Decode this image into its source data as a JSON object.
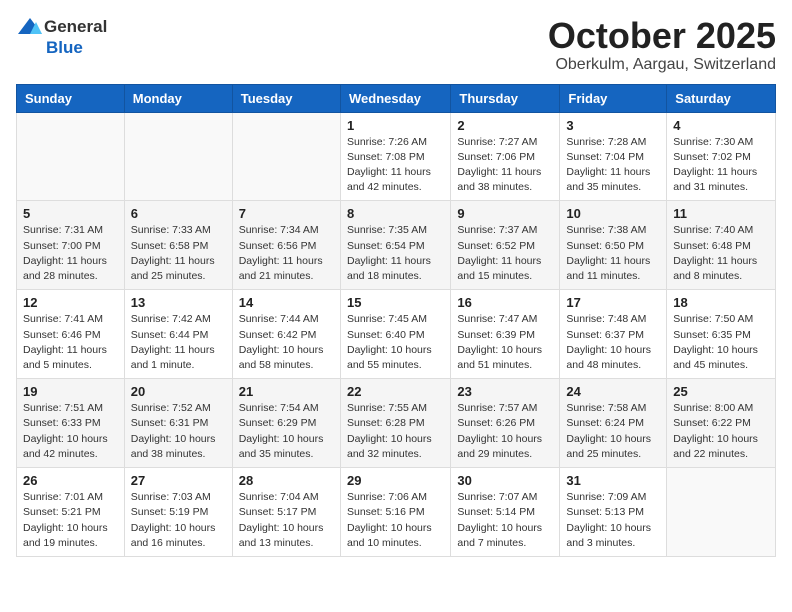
{
  "header": {
    "logo_general": "General",
    "logo_blue": "Blue",
    "month": "October 2025",
    "location": "Oberkulm, Aargau, Switzerland"
  },
  "weekdays": [
    "Sunday",
    "Monday",
    "Tuesday",
    "Wednesday",
    "Thursday",
    "Friday",
    "Saturday"
  ],
  "weeks": [
    [
      {
        "day": "",
        "sunrise": "",
        "sunset": "",
        "daylight": ""
      },
      {
        "day": "",
        "sunrise": "",
        "sunset": "",
        "daylight": ""
      },
      {
        "day": "",
        "sunrise": "",
        "sunset": "",
        "daylight": ""
      },
      {
        "day": "1",
        "sunrise": "Sunrise: 7:26 AM",
        "sunset": "Sunset: 7:08 PM",
        "daylight": "Daylight: 11 hours and 42 minutes."
      },
      {
        "day": "2",
        "sunrise": "Sunrise: 7:27 AM",
        "sunset": "Sunset: 7:06 PM",
        "daylight": "Daylight: 11 hours and 38 minutes."
      },
      {
        "day": "3",
        "sunrise": "Sunrise: 7:28 AM",
        "sunset": "Sunset: 7:04 PM",
        "daylight": "Daylight: 11 hours and 35 minutes."
      },
      {
        "day": "4",
        "sunrise": "Sunrise: 7:30 AM",
        "sunset": "Sunset: 7:02 PM",
        "daylight": "Daylight: 11 hours and 31 minutes."
      }
    ],
    [
      {
        "day": "5",
        "sunrise": "Sunrise: 7:31 AM",
        "sunset": "Sunset: 7:00 PM",
        "daylight": "Daylight: 11 hours and 28 minutes."
      },
      {
        "day": "6",
        "sunrise": "Sunrise: 7:33 AM",
        "sunset": "Sunset: 6:58 PM",
        "daylight": "Daylight: 11 hours and 25 minutes."
      },
      {
        "day": "7",
        "sunrise": "Sunrise: 7:34 AM",
        "sunset": "Sunset: 6:56 PM",
        "daylight": "Daylight: 11 hours and 21 minutes."
      },
      {
        "day": "8",
        "sunrise": "Sunrise: 7:35 AM",
        "sunset": "Sunset: 6:54 PM",
        "daylight": "Daylight: 11 hours and 18 minutes."
      },
      {
        "day": "9",
        "sunrise": "Sunrise: 7:37 AM",
        "sunset": "Sunset: 6:52 PM",
        "daylight": "Daylight: 11 hours and 15 minutes."
      },
      {
        "day": "10",
        "sunrise": "Sunrise: 7:38 AM",
        "sunset": "Sunset: 6:50 PM",
        "daylight": "Daylight: 11 hours and 11 minutes."
      },
      {
        "day": "11",
        "sunrise": "Sunrise: 7:40 AM",
        "sunset": "Sunset: 6:48 PM",
        "daylight": "Daylight: 11 hours and 8 minutes."
      }
    ],
    [
      {
        "day": "12",
        "sunrise": "Sunrise: 7:41 AM",
        "sunset": "Sunset: 6:46 PM",
        "daylight": "Daylight: 11 hours and 5 minutes."
      },
      {
        "day": "13",
        "sunrise": "Sunrise: 7:42 AM",
        "sunset": "Sunset: 6:44 PM",
        "daylight": "Daylight: 11 hours and 1 minute."
      },
      {
        "day": "14",
        "sunrise": "Sunrise: 7:44 AM",
        "sunset": "Sunset: 6:42 PM",
        "daylight": "Daylight: 10 hours and 58 minutes."
      },
      {
        "day": "15",
        "sunrise": "Sunrise: 7:45 AM",
        "sunset": "Sunset: 6:40 PM",
        "daylight": "Daylight: 10 hours and 55 minutes."
      },
      {
        "day": "16",
        "sunrise": "Sunrise: 7:47 AM",
        "sunset": "Sunset: 6:39 PM",
        "daylight": "Daylight: 10 hours and 51 minutes."
      },
      {
        "day": "17",
        "sunrise": "Sunrise: 7:48 AM",
        "sunset": "Sunset: 6:37 PM",
        "daylight": "Daylight: 10 hours and 48 minutes."
      },
      {
        "day": "18",
        "sunrise": "Sunrise: 7:50 AM",
        "sunset": "Sunset: 6:35 PM",
        "daylight": "Daylight: 10 hours and 45 minutes."
      }
    ],
    [
      {
        "day": "19",
        "sunrise": "Sunrise: 7:51 AM",
        "sunset": "Sunset: 6:33 PM",
        "daylight": "Daylight: 10 hours and 42 minutes."
      },
      {
        "day": "20",
        "sunrise": "Sunrise: 7:52 AM",
        "sunset": "Sunset: 6:31 PM",
        "daylight": "Daylight: 10 hours and 38 minutes."
      },
      {
        "day": "21",
        "sunrise": "Sunrise: 7:54 AM",
        "sunset": "Sunset: 6:29 PM",
        "daylight": "Daylight: 10 hours and 35 minutes."
      },
      {
        "day": "22",
        "sunrise": "Sunrise: 7:55 AM",
        "sunset": "Sunset: 6:28 PM",
        "daylight": "Daylight: 10 hours and 32 minutes."
      },
      {
        "day": "23",
        "sunrise": "Sunrise: 7:57 AM",
        "sunset": "Sunset: 6:26 PM",
        "daylight": "Daylight: 10 hours and 29 minutes."
      },
      {
        "day": "24",
        "sunrise": "Sunrise: 7:58 AM",
        "sunset": "Sunset: 6:24 PM",
        "daylight": "Daylight: 10 hours and 25 minutes."
      },
      {
        "day": "25",
        "sunrise": "Sunrise: 8:00 AM",
        "sunset": "Sunset: 6:22 PM",
        "daylight": "Daylight: 10 hours and 22 minutes."
      }
    ],
    [
      {
        "day": "26",
        "sunrise": "Sunrise: 7:01 AM",
        "sunset": "Sunset: 5:21 PM",
        "daylight": "Daylight: 10 hours and 19 minutes."
      },
      {
        "day": "27",
        "sunrise": "Sunrise: 7:03 AM",
        "sunset": "Sunset: 5:19 PM",
        "daylight": "Daylight: 10 hours and 16 minutes."
      },
      {
        "day": "28",
        "sunrise": "Sunrise: 7:04 AM",
        "sunset": "Sunset: 5:17 PM",
        "daylight": "Daylight: 10 hours and 13 minutes."
      },
      {
        "day": "29",
        "sunrise": "Sunrise: 7:06 AM",
        "sunset": "Sunset: 5:16 PM",
        "daylight": "Daylight: 10 hours and 10 minutes."
      },
      {
        "day": "30",
        "sunrise": "Sunrise: 7:07 AM",
        "sunset": "Sunset: 5:14 PM",
        "daylight": "Daylight: 10 hours and 7 minutes."
      },
      {
        "day": "31",
        "sunrise": "Sunrise: 7:09 AM",
        "sunset": "Sunset: 5:13 PM",
        "daylight": "Daylight: 10 hours and 3 minutes."
      },
      {
        "day": "",
        "sunrise": "",
        "sunset": "",
        "daylight": ""
      }
    ]
  ]
}
